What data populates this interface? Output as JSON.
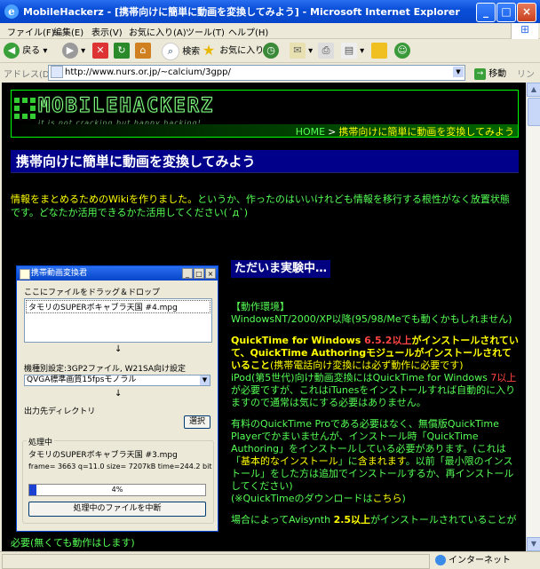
{
  "window": {
    "title": "MobileHackerz - [携帯向けに簡単に動画を変換してみよう] - Microsoft Internet Explorer"
  },
  "menu": [
    "ファイル(F)",
    "編集(E)",
    "表示(V)",
    "お気に入り(A)",
    "ツール(T)",
    "ヘルプ(H)"
  ],
  "toolbar": {
    "back": "戻る",
    "search": "検索",
    "favorites": "お気に入り"
  },
  "address": {
    "label": "アドレス(D)",
    "url": "http://www.nurs.or.jp/~calcium/3gpp/",
    "go": "移動",
    "links": "リンク"
  },
  "banner": {
    "logo": "MOBILEHACKERZ",
    "tagline": "it is not cracking but happy hacking!",
    "crumb_home": "HOME",
    "crumb_sep": ">",
    "crumb_current": "携帯向けに簡単に動画を変換してみよう"
  },
  "page": {
    "heading": "携帯向けに簡単に動画を変換してみよう",
    "intro_yellow": "情報をまとめるためのWikiを作りました。",
    "intro_green": "というか、作ったのはいいけれども情報を移行する根性がなく放置状態です。どなたか活用できるかた活用してください(´д`)"
  },
  "app": {
    "title": "携帯動画変換君",
    "drop_label": "ここにファイルをドラッグ＆ドロップ",
    "file_item": "タモリのSUPERボキャブラ天国 #4.mpg",
    "arrow": "↓",
    "device_label": "機種別設定:3GP2ファイル, W21SA向け設定",
    "quality": "QVGA標準画質15fpsモノラル",
    "output_label": "出力先ディレクトリ",
    "browse": "選択",
    "group_label": "処理中",
    "processing_file": "タモリのSUPERボキャブラ天国 #3.mpg",
    "processing_stats": "frame= 3663 q=11.0 size=   7207kB time=244.2 bit",
    "progress_label": "4%",
    "progress_value": 4,
    "abort": "処理中のファイルを中断"
  },
  "right": {
    "heading": "ただいま実験中…",
    "env_title": "【動作環境】",
    "env_text": "WindowsNT/2000/XP以降(95/98/Meでも動くかもしれません)",
    "qt_a": "QuickTime for Windows ",
    "qt_ver": "6.5.2以上",
    "qt_b": "がインストールされていて、QuickTime Authoringモジュールがインストールされていること",
    "qt_c": "(携帯電話向け変換には必ず動作に必要です)",
    "ipod_a": "iPod(第5世代)向け動画変換にはQuickTime for Windows ",
    "ipod_ver": "7以上",
    "ipod_b": "が必要ですが、これはiTunesをインストールすれば自動的に入りますので通常は気にする必要はありません。",
    "pro_a": "有料のQuickTime Proである必要はなく、無償版QuickTime Playerでかまいませんが、インストール時「QuickTime Authoring」をインストールしている必要があります。(これは「",
    "pro_basic": "基本的なインストール",
    "pro_b": "」に",
    "pro_included": "含まれます",
    "pro_c": "。以前「最小限のインストール」をした方は追加でインストールするか、再インストールしてください)",
    "qt_dl_a": "(※QuickTimeのダウンロードは",
    "qt_dl_link": "こちら",
    "qt_dl_b": ")",
    "avisynth_a": "場合によってAvisynth ",
    "avisynth_ver": "2.5以上",
    "avisynth_b": "がインストールされていることが"
  },
  "bottom_line": "必要(無くても動作はします)",
  "status": {
    "zone": "インターネット"
  }
}
